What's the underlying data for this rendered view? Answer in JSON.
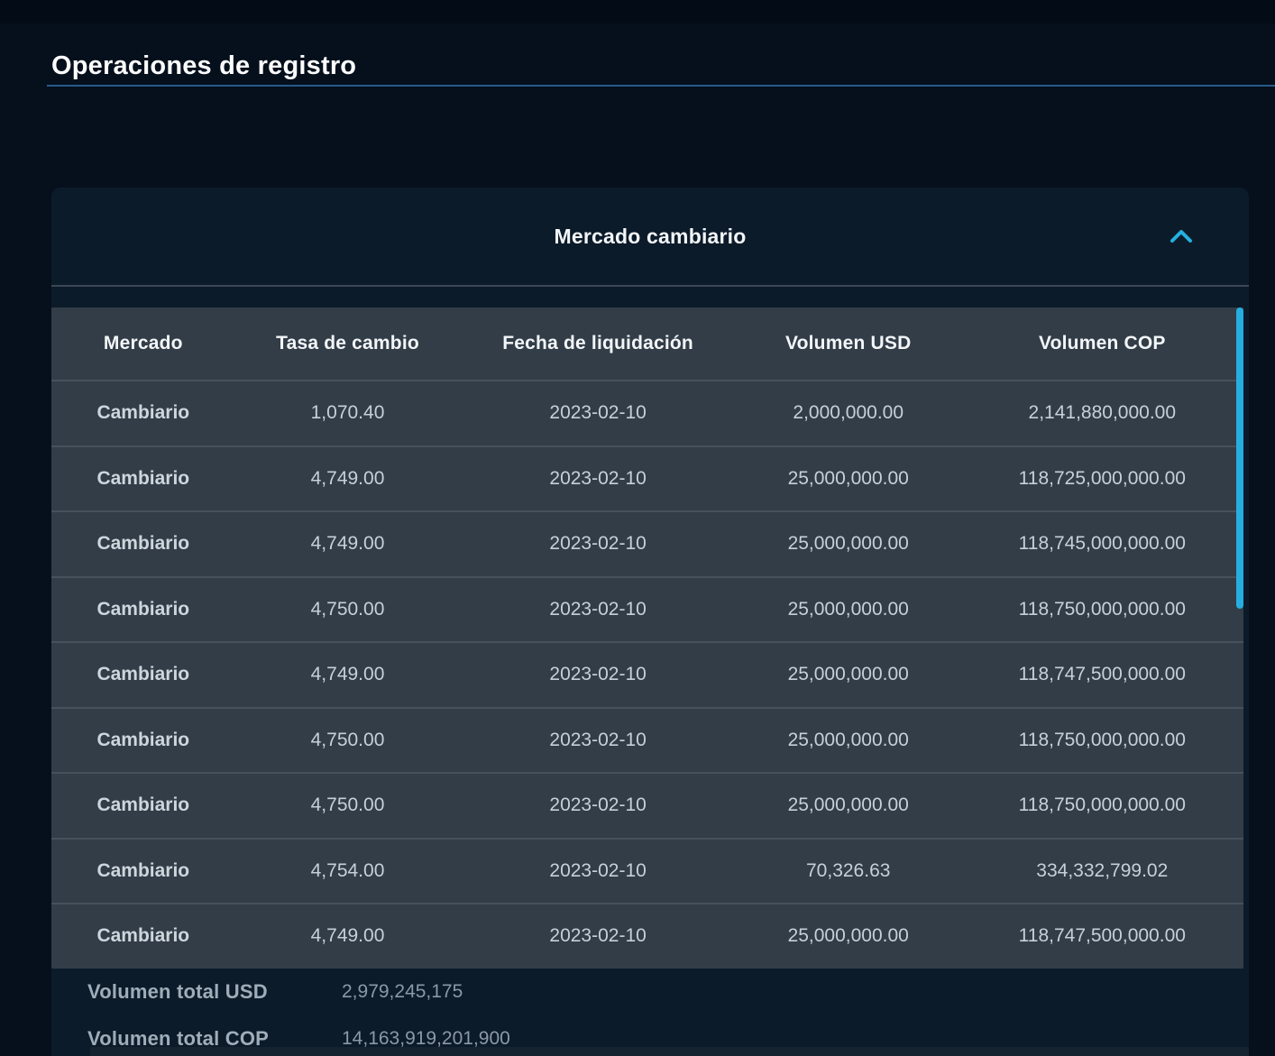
{
  "page": {
    "title": "Operaciones de registro"
  },
  "panel": {
    "title": "Mercado cambiario",
    "collapse_icon": "chevron-up"
  },
  "table": {
    "columns": [
      "Mercado",
      "Tasa de cambio",
      "Fecha de liquidación",
      "Volumen USD",
      "Volumen COP"
    ],
    "rows": [
      [
        "Cambiario",
        "1,070.40",
        "2023-02-10",
        "2,000,000.00",
        "2,141,880,000.00"
      ],
      [
        "Cambiario",
        "4,749.00",
        "2023-02-10",
        "25,000,000.00",
        "118,725,000,000.00"
      ],
      [
        "Cambiario",
        "4,749.00",
        "2023-02-10",
        "25,000,000.00",
        "118,745,000,000.00"
      ],
      [
        "Cambiario",
        "4,750.00",
        "2023-02-10",
        "25,000,000.00",
        "118,750,000,000.00"
      ],
      [
        "Cambiario",
        "4,749.00",
        "2023-02-10",
        "25,000,000.00",
        "118,747,500,000.00"
      ],
      [
        "Cambiario",
        "4,750.00",
        "2023-02-10",
        "25,000,000.00",
        "118,750,000,000.00"
      ],
      [
        "Cambiario",
        "4,750.00",
        "2023-02-10",
        "25,000,000.00",
        "118,750,000,000.00"
      ],
      [
        "Cambiario",
        "4,754.00",
        "2023-02-10",
        "70,326.63",
        "334,332,799.02"
      ],
      [
        "Cambiario",
        "4,749.00",
        "2023-02-10",
        "25,000,000.00",
        "118,747,500,000.00"
      ]
    ],
    "totals": [
      {
        "label": "Volumen total USD",
        "value": "2,979,245,175"
      },
      {
        "label": "Volumen total COP",
        "value": "14,163,919,201,900"
      }
    ]
  },
  "colors": {
    "page_bg": "#05101c",
    "panel_bg": "#0c1b2a",
    "row_bg": "#323d48",
    "divider": "#46515c",
    "accent_cyan": "#25afe0",
    "underline_blue": "#27598a",
    "header_text": "#f3f6f8",
    "cell_text": "#c7d0d8",
    "total_label": "#9fadb8",
    "total_value": "#8b99a5"
  }
}
